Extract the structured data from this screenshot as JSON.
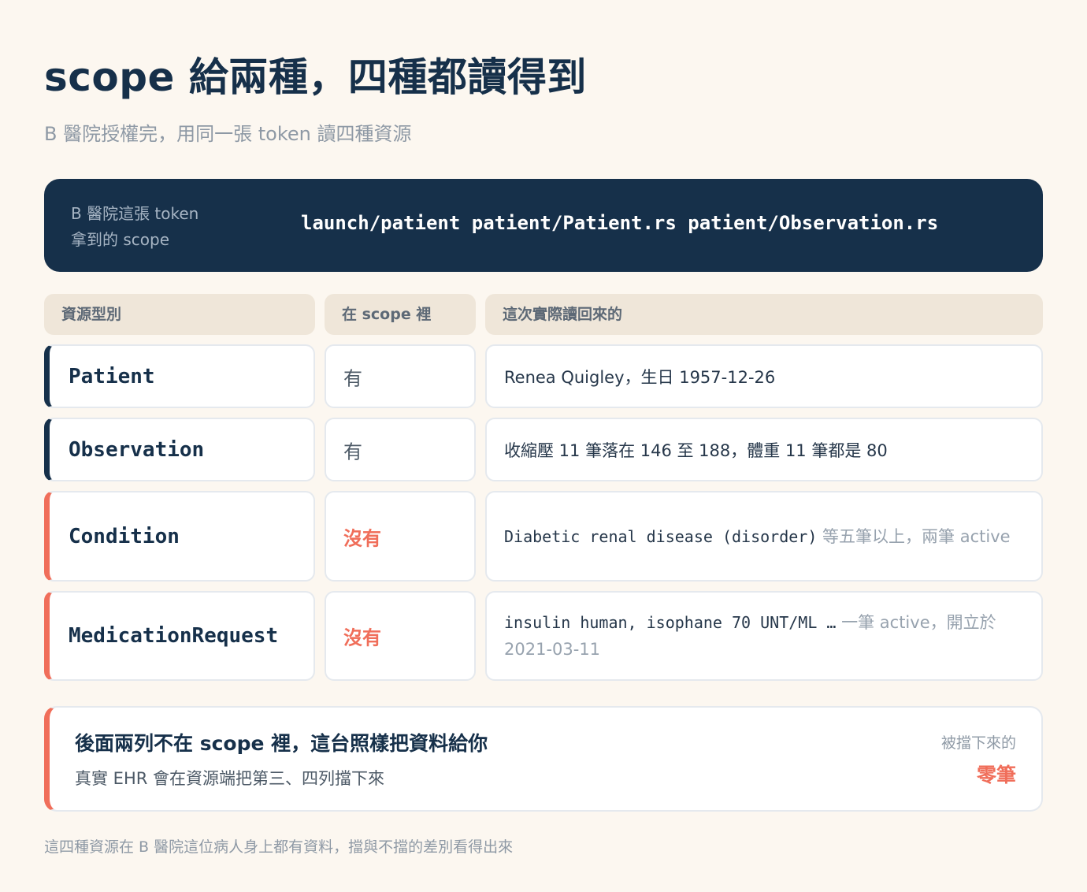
{
  "title": "scope 給兩種，四種都讀得到",
  "subtitle": "B 醫院授權完，用同一張 token 讀四種資源",
  "token_panel": {
    "label_line1": "B 醫院這張 token",
    "label_line2": "拿到的 scope",
    "scopes": "launch/patient patient/Patient.rs patient/Observation.rs"
  },
  "table": {
    "headers": {
      "type": "資源型別",
      "in_scope": "在 scope 裡",
      "result": "這次實際讀回來的"
    },
    "rows": [
      {
        "type": "Patient",
        "in_scope": "有",
        "result": "Renea Quigley，生日 1957-12-26"
      },
      {
        "type": "Observation",
        "in_scope": "有",
        "result": "收縮壓 11 筆落在 146 至 188，體重 11 筆都是 80"
      },
      {
        "type": "Condition",
        "in_scope": "沒有",
        "result_code": "Diabetic renal disease (disorder)",
        "result_note": " 等五筆以上，兩筆 active"
      },
      {
        "type": "MedicationRequest",
        "in_scope": "沒有",
        "result_code": "insulin human, isophane 70 UNT/ML …",
        "result_note": " 一筆 active，開立於 2021-03-11"
      }
    ]
  },
  "note": {
    "title": "後面兩列不在 scope 裡，這台照樣把資料給你",
    "description": "真實 EHR 會在資源端把第三、四列擋下來",
    "side_label": "被擋下來的",
    "side_value": "零筆"
  },
  "footer": "這四種資源在 B 醫院這位病人身上都有資料，擋與不擋的差別看得出來",
  "colors": {
    "background": "#fcf7f0",
    "navy": "#16304a",
    "accent_red": "#f06e5a",
    "header_beige": "#efe6d9"
  }
}
